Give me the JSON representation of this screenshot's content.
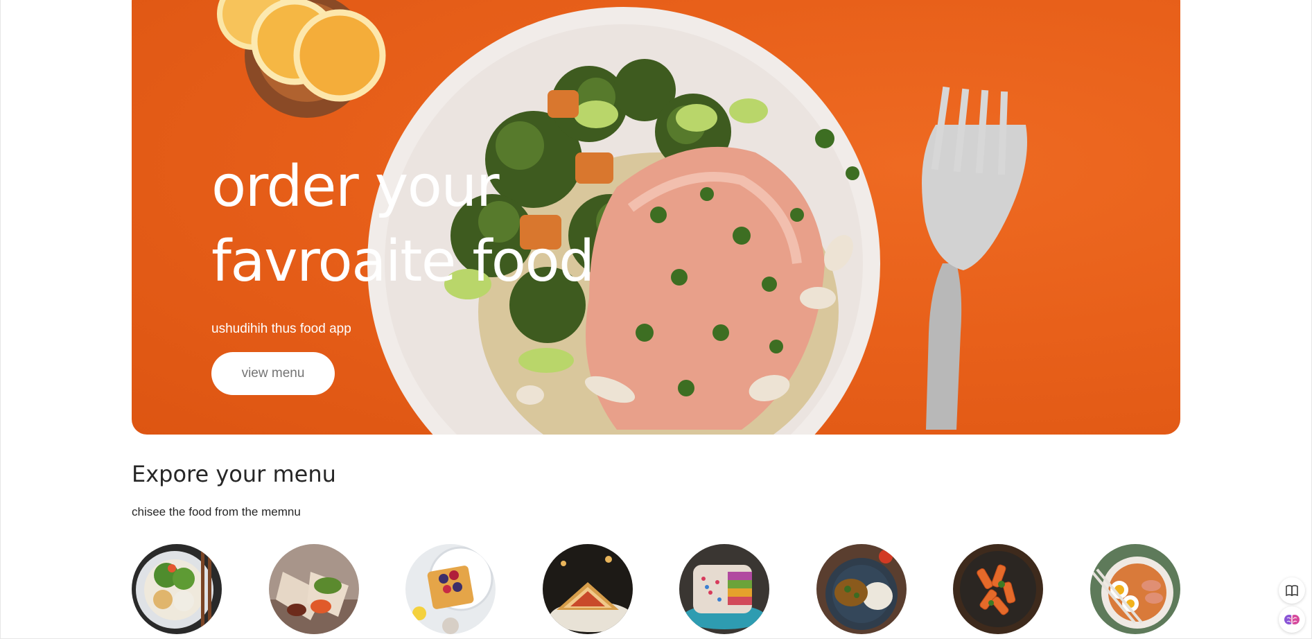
{
  "hero": {
    "title_line1": "order your",
    "title_line2": "favroaite food",
    "subtitle": "ushudihih thus food app",
    "button_label": "view menu"
  },
  "explore": {
    "title": "Expore your menu",
    "subtitle": "chisee the food from the memnu"
  },
  "menu_items": [
    {
      "icon": "salad-icon"
    },
    {
      "icon": "rolls-icon"
    },
    {
      "icon": "deserts-icon"
    },
    {
      "icon": "sandwich-icon"
    },
    {
      "icon": "cake-icon"
    },
    {
      "icon": "pure-veg-icon"
    },
    {
      "icon": "pasta-icon"
    },
    {
      "icon": "noodles-icon"
    }
  ],
  "colors": {
    "hero_background": "#e8601a",
    "text_primary": "#262626",
    "button_text": "#747474"
  },
  "side_widgets": [
    {
      "icon": "book-icon"
    },
    {
      "icon": "brain-icon"
    }
  ]
}
